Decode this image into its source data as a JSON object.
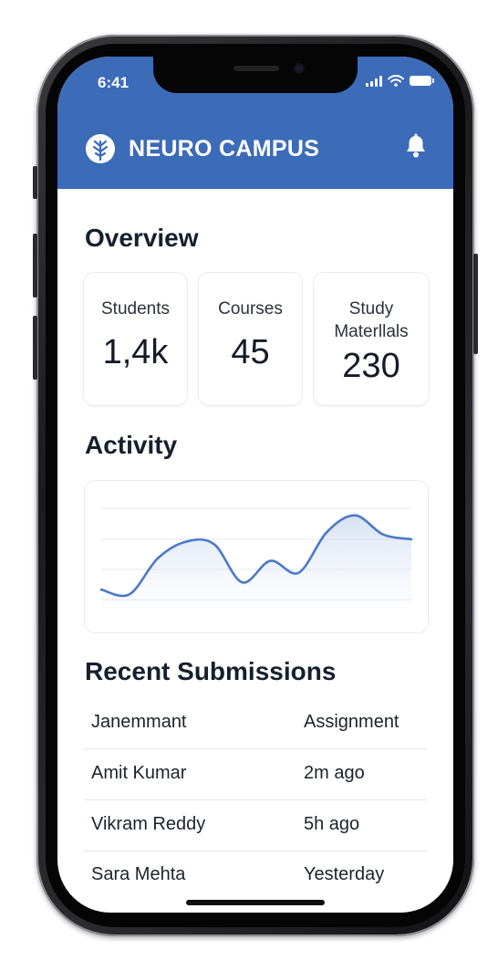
{
  "status_bar": {
    "time": "6:41"
  },
  "header": {
    "app_title": "NEURO CAMPUS",
    "logo_icon": "brain-tree-icon",
    "bell_icon": "bell-icon",
    "accent_color": "#3c6bb8"
  },
  "overview": {
    "title": "Overview",
    "cards": [
      {
        "label": "Students",
        "value": "1,4k"
      },
      {
        "label": "Courses",
        "value": "45"
      },
      {
        "label_line1": "Study",
        "label_line2": "Materllals",
        "value": "230"
      }
    ]
  },
  "activity": {
    "title": "Activity",
    "chart_data": {
      "type": "area",
      "x": [
        1,
        2,
        3,
        4,
        5,
        6,
        7,
        8,
        9,
        10,
        11,
        12,
        13,
        14,
        15,
        16
      ],
      "y": [
        1.6,
        1.2,
        4.2,
        5.6,
        5.4,
        2.2,
        4.0,
        3.0,
        6.4,
        7.8,
        6.2,
        5.8
      ],
      "grid": true,
      "line_color": "#4a79c8"
    }
  },
  "recent_submissions": {
    "title": "Recent Submissions",
    "header": {
      "name": "Janemmant",
      "meta": "Assignment"
    },
    "rows": [
      {
        "name": "Amit Kumar",
        "meta": "2m ago"
      },
      {
        "name": "Vikram Reddy",
        "meta": "5h ago"
      },
      {
        "name": "Sara Mehta",
        "meta": "Yesterday"
      }
    ]
  }
}
